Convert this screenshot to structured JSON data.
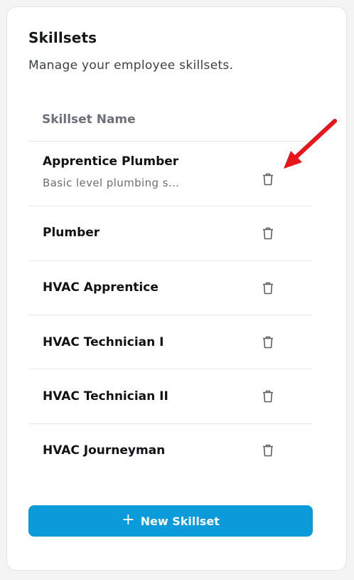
{
  "card": {
    "title": "Skillsets",
    "subtitle": "Manage your employee skillsets."
  },
  "table": {
    "column_header": "Skillset Name",
    "rows": [
      {
        "name": "Apprentice Plumber",
        "description": "Basic level plumbing s..."
      },
      {
        "name": "Plumber",
        "description": ""
      },
      {
        "name": "HVAC Apprentice",
        "description": ""
      },
      {
        "name": "HVAC Technician I",
        "description": ""
      },
      {
        "name": "HVAC Technician II",
        "description": ""
      },
      {
        "name": "HVAC Journeyman",
        "description": ""
      }
    ],
    "row_action_icon": "trash-icon"
  },
  "new_button": {
    "label": "New Skillset",
    "icon": "plus-icon"
  },
  "annotation": {
    "icon": "red-arrow",
    "color": "#e8161b"
  },
  "colors": {
    "accent": "#0b9ada",
    "text": "#111214",
    "muted": "#6b7079"
  }
}
